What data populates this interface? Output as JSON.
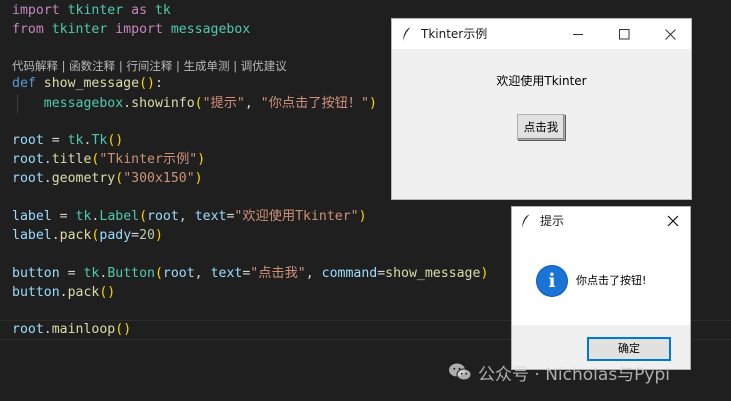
{
  "editor": {
    "code": {
      "line1": {
        "kw": "import",
        "mod": "tkinter",
        "as": "as",
        "alias": "tk"
      },
      "line2": {
        "from": "from",
        "mod": "tkinter",
        "import": "import",
        "name": "messagebox"
      },
      "hint": "代码解释 | 函数注释 | 行间注释 | 生成单测 | 调优建议",
      "line4": {
        "def": "def",
        "fn": "show_message",
        "rest": ":"
      },
      "line5": {
        "obj": "messagebox",
        "method": "showinfo",
        "arg1": "\"提示\"",
        "arg2": "\"你点击了按钮！\""
      },
      "line7": {
        "var": "root",
        "mod": "tk",
        "cls": "Tk"
      },
      "line8": {
        "var": "root",
        "method": "title",
        "arg": "\"Tkinter示例\""
      },
      "line9": {
        "var": "root",
        "method": "geometry",
        "arg": "\"300x150\""
      },
      "line11": {
        "var": "label",
        "mod": "tk",
        "cls": "Label",
        "arg0": "root",
        "kw1": "text",
        "val1": "\"欢迎使用Tkinter\""
      },
      "line12": {
        "var": "label",
        "method": "pack",
        "kw": "pady",
        "val": "20"
      },
      "line14": {
        "var": "button",
        "mod": "tk",
        "cls": "Button",
        "arg0": "root",
        "kw1": "text",
        "val1": "\"点击我\"",
        "kw2": "command",
        "val2": "show_message"
      },
      "line15": {
        "var": "button",
        "method": "pack"
      },
      "line17": {
        "var": "root",
        "method": "mainloop"
      }
    }
  },
  "tk_window": {
    "title": "Tkinter示例",
    "label": "欢迎使用Tkinter",
    "button": "点击我"
  },
  "messagebox": {
    "title": "提示",
    "message": "你点击了按钮!",
    "ok": "确定"
  },
  "watermark": {
    "text": "公众号 · Nicholas与Pypi"
  },
  "colors": {
    "editor_bg": "#1f1f1f",
    "accent": "#0078d7"
  },
  "icons": [
    "feather-icon",
    "minimize-icon",
    "maximize-icon",
    "close-icon",
    "info-icon",
    "wechat-icon"
  ]
}
